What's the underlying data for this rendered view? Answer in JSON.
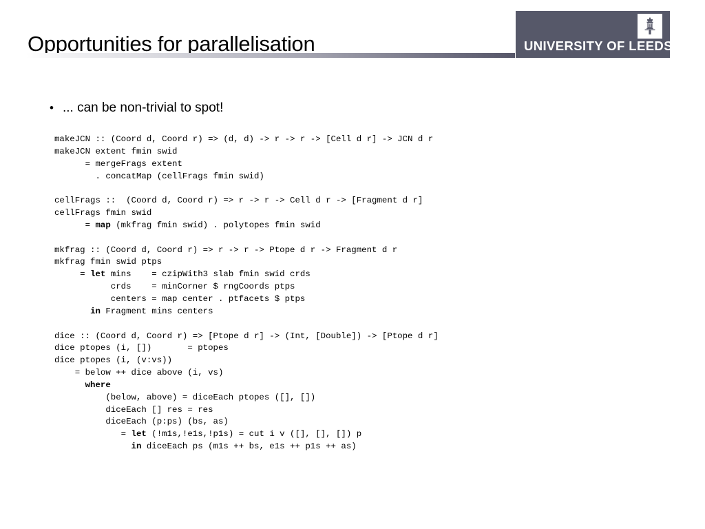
{
  "slide": {
    "title": "Opportunities for parallelisation",
    "background_color": "#ffffff",
    "rule_end_color": "#565668"
  },
  "logo": {
    "wordmark": "UNIVERSITY OF LEEDS",
    "background_color": "#565869",
    "text_color": "#ffffff",
    "crest_icon": "leeds-crest-tower-icon"
  },
  "body": {
    "bullet": {
      "marker": "•",
      "text": "... can be non-trivial to spot!"
    },
    "code_lines": [
      "makeJCN :: (Coord d, Coord r) => (d, d) -> r -> r -> [Cell d r] -> JCN d r",
      "makeJCN extent fmin swid",
      "      = mergeFrags extent",
      "        . concatMap (cellFrags fmin swid)",
      "",
      "cellFrags ::  (Coord d, Coord r) => r -> r -> Cell d r -> [Fragment d r]",
      "cellFrags fmin swid",
      "      = <b>map</b> (mkfrag fmin swid) . polytopes fmin swid",
      "",
      "mkfrag :: (Coord d, Coord r) => r -> r -> Ptope d r -> Fragment d r",
      "mkfrag fmin swid ptps",
      "     = <b>let</b> mins    = czipWith3 slab fmin swid crds",
      "           crds    = minCorner $ rngCoords ptps",
      "           centers = map center . ptfacets $ ptps",
      "       <b>in</b> Fragment mins centers",
      "",
      "dice :: (Coord d, Coord r) => [Ptope d r] -> (Int, [Double]) -> [Ptope d r]",
      "dice ptopes (i, [])       = ptopes",
      "dice ptopes (i, (v:vs))",
      "    = below ++ dice above (i, vs)",
      "      <b>where</b>",
      "          (below, above) = diceEach ptopes ([], [])",
      "          diceEach [] res = res",
      "          diceEach (p:ps) (bs, as)",
      "             = <b>let</b> (!m1s,!e1s,!p1s) = cut i v ([], [], []) p",
      "               <b>in</b> diceEach ps (m1s ++ bs, e1s ++ p1s ++ as)"
    ]
  }
}
